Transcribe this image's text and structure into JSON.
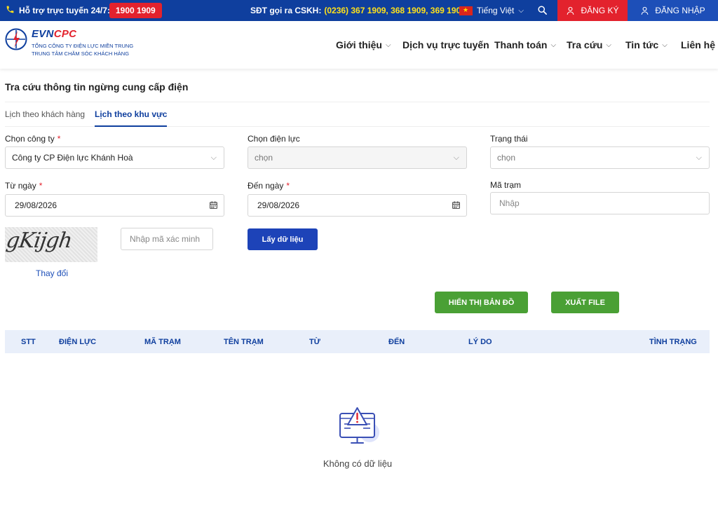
{
  "topbar": {
    "support_label": "Hỗ trợ trực tuyến 24/7:",
    "hotline": "1900 1909",
    "cskh_label": "SĐT gọi ra CSKH:",
    "cskh_numbers": "(0236) 367 1909, 368 1909, 369 1909",
    "language": "Tiếng Việt",
    "register": "ĐĂNG KÝ",
    "login": "ĐĂNG NHẬP",
    "colors": {
      "bar": "#0f3f9e",
      "accent_red": "#e3222d",
      "numbers_yellow": "#ffe11a"
    }
  },
  "header": {
    "brand_evn": "EVN",
    "brand_cpc": "CPC",
    "org_line1": "TỔNG CÔNG TY ĐIỆN LỰC MIỀN TRUNG",
    "org_line2": "TRUNG TÂM CHĂM SÓC KHÁCH HÀNG",
    "nav": [
      {
        "label": "Giới thiệu",
        "has_dropdown": true
      },
      {
        "label": "Dịch vụ trực tuyến",
        "has_dropdown": false
      },
      {
        "label": "Thanh toán",
        "has_dropdown": true
      },
      {
        "label": "Tra cứu",
        "has_dropdown": true
      },
      {
        "label": "Tin tức",
        "has_dropdown": true
      },
      {
        "label": "Liên hệ",
        "has_dropdown": false
      }
    ]
  },
  "page": {
    "title": "Tra cứu thông tin ngừng cung cấp điện",
    "tabs": [
      {
        "label": "Lịch theo khách hàng",
        "active": false
      },
      {
        "label": "Lịch theo khu vực",
        "active": true
      }
    ]
  },
  "form": {
    "company": {
      "label": "Chọn công ty",
      "required": "*",
      "value": "Công ty CP Điện lực Khánh Hoà"
    },
    "power_unit": {
      "label": "Chọn điện lực",
      "value": "chọn"
    },
    "status": {
      "label": "Trạng thái",
      "value": "chọn"
    },
    "from_date": {
      "label": "Từ ngày",
      "required": "*",
      "value": "29/08/2026"
    },
    "to_date": {
      "label": "Đến ngày",
      "required": "*",
      "value": "29/08/2026"
    },
    "station_code": {
      "label": "Mã trạm",
      "placeholder": "Nhập"
    },
    "captcha": {
      "text": "gKijgh",
      "change_label": "Thay đổi",
      "input_placeholder": "Nhập mã xác minh"
    },
    "fetch_button": "Lấy dữ liệu",
    "map_button": "HIỂN THỊ BẢN ĐỒ",
    "export_button": "XUẤT FILE"
  },
  "table": {
    "columns": [
      "STT",
      "ĐIỆN LỰC",
      "MÃ TRẠM",
      "TÊN TRẠM",
      "TỪ",
      "ĐẾN",
      "LÝ DO",
      "TÌNH TRẠNG"
    ],
    "rows": [],
    "empty_text": "Không có dữ liệu"
  }
}
